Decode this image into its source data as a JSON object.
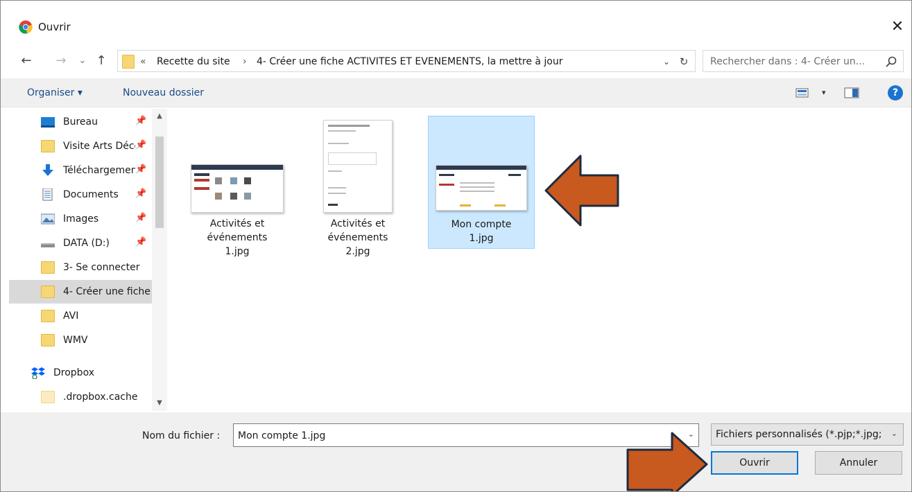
{
  "window": {
    "title": "Ouvrir",
    "close_glyph": "✕"
  },
  "nav": {
    "back_glyph": "←",
    "forward_glyph": "→",
    "recent_glyph": "⌄",
    "up_glyph": "↑",
    "address": {
      "overflow": "«",
      "segment1": "Recette du site",
      "separator": "›",
      "segment2": "4- Créer une fiche ACTIVITES ET EVENEMENTS, la mettre à jour",
      "dropdown_glyph": "⌄",
      "refresh_glyph": "↻"
    },
    "search_placeholder": "Rechercher dans : 4- Créer un..."
  },
  "commands": {
    "organize": "Organiser ▾",
    "new_folder": "Nouveau dossier",
    "view_dd_glyph": "▾",
    "help_glyph": "?"
  },
  "sidebar": {
    "items": [
      {
        "label": "Bureau",
        "icon": "desktop-icon",
        "pinned": true
      },
      {
        "label": "Visite Arts Décoratifs",
        "icon": "folder-icon",
        "pinned": true
      },
      {
        "label": "Téléchargements",
        "icon": "download-icon",
        "pinned": true
      },
      {
        "label": "Documents",
        "icon": "documents-icon",
        "pinned": true
      },
      {
        "label": "Images",
        "icon": "pictures-icon",
        "pinned": true
      },
      {
        "label": "DATA (D:)",
        "icon": "drive-icon",
        "pinned": true
      },
      {
        "label": "3- Se connecter",
        "icon": "folder-icon",
        "pinned": false
      },
      {
        "label": "4- Créer une fiche",
        "icon": "folder-icon",
        "pinned": false,
        "selected": true
      },
      {
        "label": "AVI",
        "icon": "folder-icon",
        "pinned": false
      },
      {
        "label": "WMV",
        "icon": "folder-icon",
        "pinned": false
      },
      {
        "label": "Dropbox",
        "icon": "dropbox-icon",
        "pinned": false
      },
      {
        "label": ".dropbox.cache",
        "icon": "folder-icon",
        "pinned": false
      }
    ],
    "pin_glyph": "📌",
    "scroll_up_glyph": "▲",
    "scroll_down_glyph": "▼"
  },
  "files": [
    {
      "line1": "Activités et",
      "line2": "événements",
      "line3": "1.jpg",
      "selected": false
    },
    {
      "line1": "Activités et",
      "line2": "événements",
      "line3": "2.jpg",
      "selected": false
    },
    {
      "line1": "Mon compte",
      "line2": "1.jpg",
      "line3": "",
      "selected": true
    }
  ],
  "footer": {
    "filename_label": "Nom du fichier :",
    "filename_value": "Mon compte 1.jpg",
    "filter_value": "Fichiers personnalisés (*.pjp;*.jpg;*.jpeg)",
    "dropdown_glyph": "⌄",
    "open_label": "Ouvrir",
    "cancel_label": "Annuler"
  },
  "colors": {
    "accent": "#0078d7",
    "selection": "#cce8ff",
    "arrow_fill": "#c8591f",
    "arrow_stroke": "#1f2b3d"
  }
}
